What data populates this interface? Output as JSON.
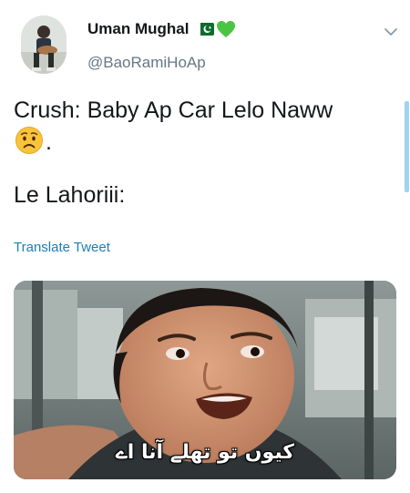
{
  "author": {
    "display_name": "Uman Mughal",
    "handle": "@BaoRamiHoAp",
    "name_emojis": [
      "pakistan-flag-icon",
      "green-heart-icon"
    ]
  },
  "tweet": {
    "line1": "Crush: Baby Ap Car Lelo Naww",
    "line1_end": ".",
    "line2": "Le Lahoriii:",
    "emoji": "worried-face-icon"
  },
  "translate_label": "Translate Tweet",
  "media": {
    "subtitle": "کیوں تو تھلے آنا اے"
  },
  "colors": {
    "handle": "#657786",
    "link": "#1b7fb8",
    "accent": "#9fd3f0"
  }
}
